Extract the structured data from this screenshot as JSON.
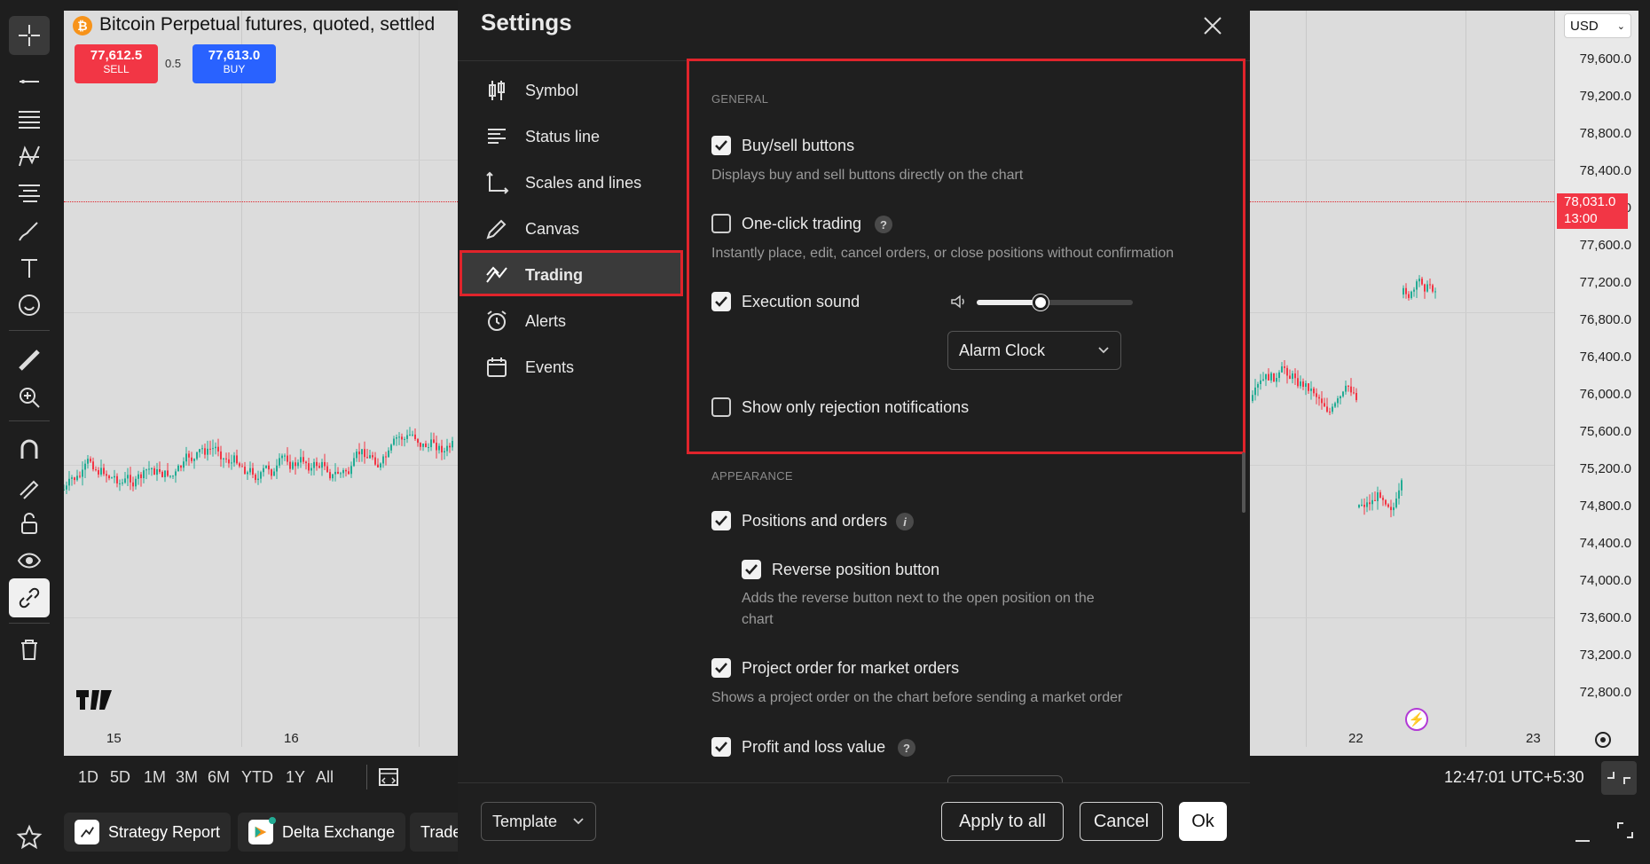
{
  "chart": {
    "symbol_title": "Bitcoin Perpetual futures, quoted, settled",
    "sell_price": "77,612.5",
    "sell_label": "SELL",
    "spread": "0.5",
    "buy_price": "77,613.0",
    "buy_label": "BUY",
    "currency": "USD",
    "last_price": "78,031.0",
    "countdown": "13:00",
    "price_ticks": [
      "79,600.0",
      "79,200.0",
      "78,800.0",
      "78,400.0",
      "78,000.0",
      "77,600.0",
      "77,200.0",
      "76,800.0",
      "76,400.0",
      "76,000.0",
      "75,600.0",
      "75,200.0",
      "74,800.0",
      "74,400.0",
      "74,000.0",
      "73,600.0",
      "73,200.0",
      "72,800.0"
    ],
    "date_ticks": [
      "15",
      "16",
      "22",
      "23"
    ],
    "ranges": [
      "1D",
      "5D",
      "1M",
      "3M",
      "6M",
      "YTD",
      "1Y",
      "All"
    ],
    "clock": "12:47:01 UTC+5:30",
    "colors": {
      "up": "#22ab94",
      "down": "#f23645",
      "accent_red": "#e0242b"
    }
  },
  "bottom_tabs": [
    {
      "label": "Strategy Report",
      "icon": "strategy-icon"
    },
    {
      "label": "Delta Exchange",
      "icon": "delta-exchange-icon"
    },
    {
      "label": "Trade"
    }
  ],
  "settings": {
    "title": "Settings",
    "nav": [
      {
        "label": "Symbol",
        "icon": "candles-icon"
      },
      {
        "label": "Status line",
        "icon": "status-line-icon"
      },
      {
        "label": "Scales and lines",
        "icon": "scales-icon"
      },
      {
        "label": "Canvas",
        "icon": "pencil-icon"
      },
      {
        "label": "Trading",
        "icon": "trading-icon",
        "active": true
      },
      {
        "label": "Alerts",
        "icon": "alarm-clock-icon"
      },
      {
        "label": "Events",
        "icon": "calendar-icon"
      }
    ],
    "general": {
      "heading": "GENERAL",
      "buy_sell": {
        "label": "Buy/sell buttons",
        "desc": "Displays buy and sell buttons directly on the chart",
        "checked": true
      },
      "one_click": {
        "label": "One-click trading",
        "desc": "Instantly place, edit, cancel orders, or close positions without confirmation",
        "checked": false
      },
      "execution_sound": {
        "label": "Execution sound",
        "checked": true,
        "volume": 0.5,
        "sound": "Alarm Clock"
      },
      "rejection_only": {
        "label": "Show only rejection notifications",
        "checked": false
      }
    },
    "appearance": {
      "heading": "APPEARANCE",
      "positions_orders": {
        "label": "Positions and orders",
        "checked": true
      },
      "reverse_position": {
        "label": "Reverse position button",
        "desc": "Adds the reverse button next to the open position on the chart",
        "checked": true
      },
      "project_order": {
        "label": "Project order for market orders",
        "desc": "Shows a project order on the chart before sending a market order",
        "checked": true
      },
      "pnl_value": {
        "label": "Profit and loss value",
        "checked": true
      }
    },
    "footer": {
      "template": "Template",
      "apply_all": "Apply to all",
      "cancel": "Cancel",
      "ok": "Ok"
    }
  }
}
